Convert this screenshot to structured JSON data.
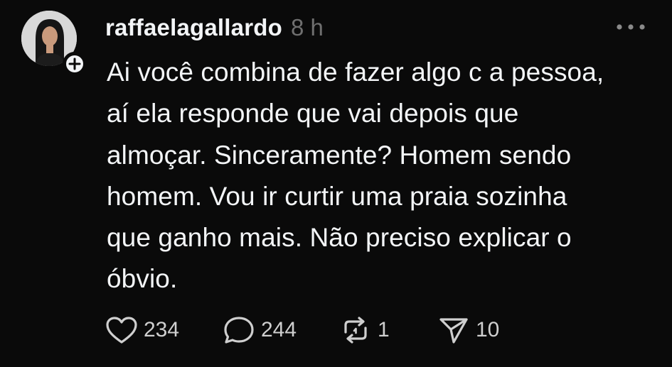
{
  "post": {
    "username": "raffaelagallardo",
    "timestamp": "8 h",
    "text_lines": [
      "Ai você combina de fazer algo c a pessoa,",
      "aí ela responde que vai depois que",
      "almoçar. Sinceramente? Homem sendo",
      "homem. Vou ir curtir uma praia sozinha",
      "que ganho mais. Não preciso explicar o",
      "óbvio."
    ],
    "actions": {
      "likes": "234",
      "replies": "244",
      "reposts": "1",
      "shares": "10"
    }
  },
  "icons": {
    "more": "more-dots-icon",
    "follow": "plus-icon",
    "like": "heart-icon",
    "reply": "comment-icon",
    "repost": "repost-icon",
    "share": "send-icon"
  },
  "colors": {
    "background": "#0a0a0a",
    "text_primary": "#f3f5f7",
    "text_secondary": "#6f6f6f",
    "icon": "#cfcfcf"
  }
}
